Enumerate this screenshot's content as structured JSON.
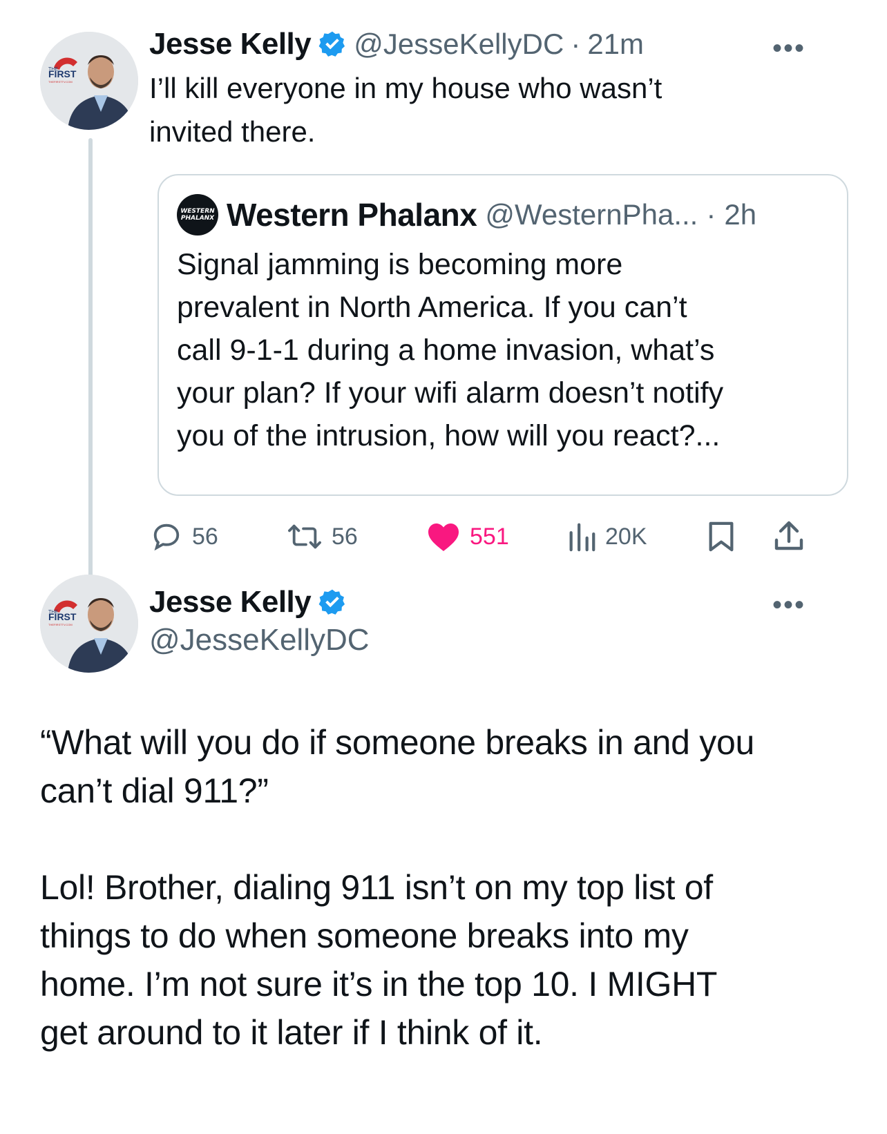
{
  "parent_tweet": {
    "author_name": "Jesse Kelly",
    "author_handle": "@JesseKellyDC",
    "separator": "·",
    "time": "21m",
    "text_line1": "I’ll kill everyone in my house who wasn’t",
    "text_line2": "invited there.",
    "avatar_badge_line1": "THE",
    "avatar_badge_line2": "FIRST",
    "avatar_badge_line3": "THEFIRSTTV.COM",
    "more_label": "•••"
  },
  "quoted_tweet": {
    "author_name": "Western Phalanx",
    "author_handle": "@WesternPha...",
    "separator": "·",
    "time": "2h",
    "avatar_line1": "WESTERN",
    "avatar_line2": "PHALANX",
    "lines": [
      "Signal jamming is becoming more",
      "prevalent in North America. If you can’t",
      "call 9-1-1 during a home invasion, what’s",
      "your plan? If your wifi alarm doesn’t notify",
      "you of the intrusion, how will you react?..."
    ]
  },
  "actions": {
    "replies": "56",
    "reposts": "56",
    "likes": "551",
    "views": "20K",
    "like_color": "#f91880",
    "icons": [
      "reply-icon",
      "repost-icon",
      "heart-icon",
      "views-icon",
      "bookmark-icon",
      "share-icon"
    ]
  },
  "main_tweet": {
    "author_name": "Jesse Kelly",
    "author_handle": "@JesseKellyDC",
    "more_label": "•••",
    "paragraph1": [
      "“What will you do if someone breaks in and you",
      "can’t dial 911?”"
    ],
    "paragraph2": [
      "Lol! Brother, dialing 911 isn’t on my top list of",
      "things to do when someone breaks into my",
      "home. I’m not sure it’s in the top 10. I MIGHT",
      "get around to it later if I think of it."
    ]
  },
  "colors": {
    "text": "#0f1419",
    "secondary": "#536471",
    "verified": "#1d9bf0",
    "border": "#cfd9de"
  }
}
